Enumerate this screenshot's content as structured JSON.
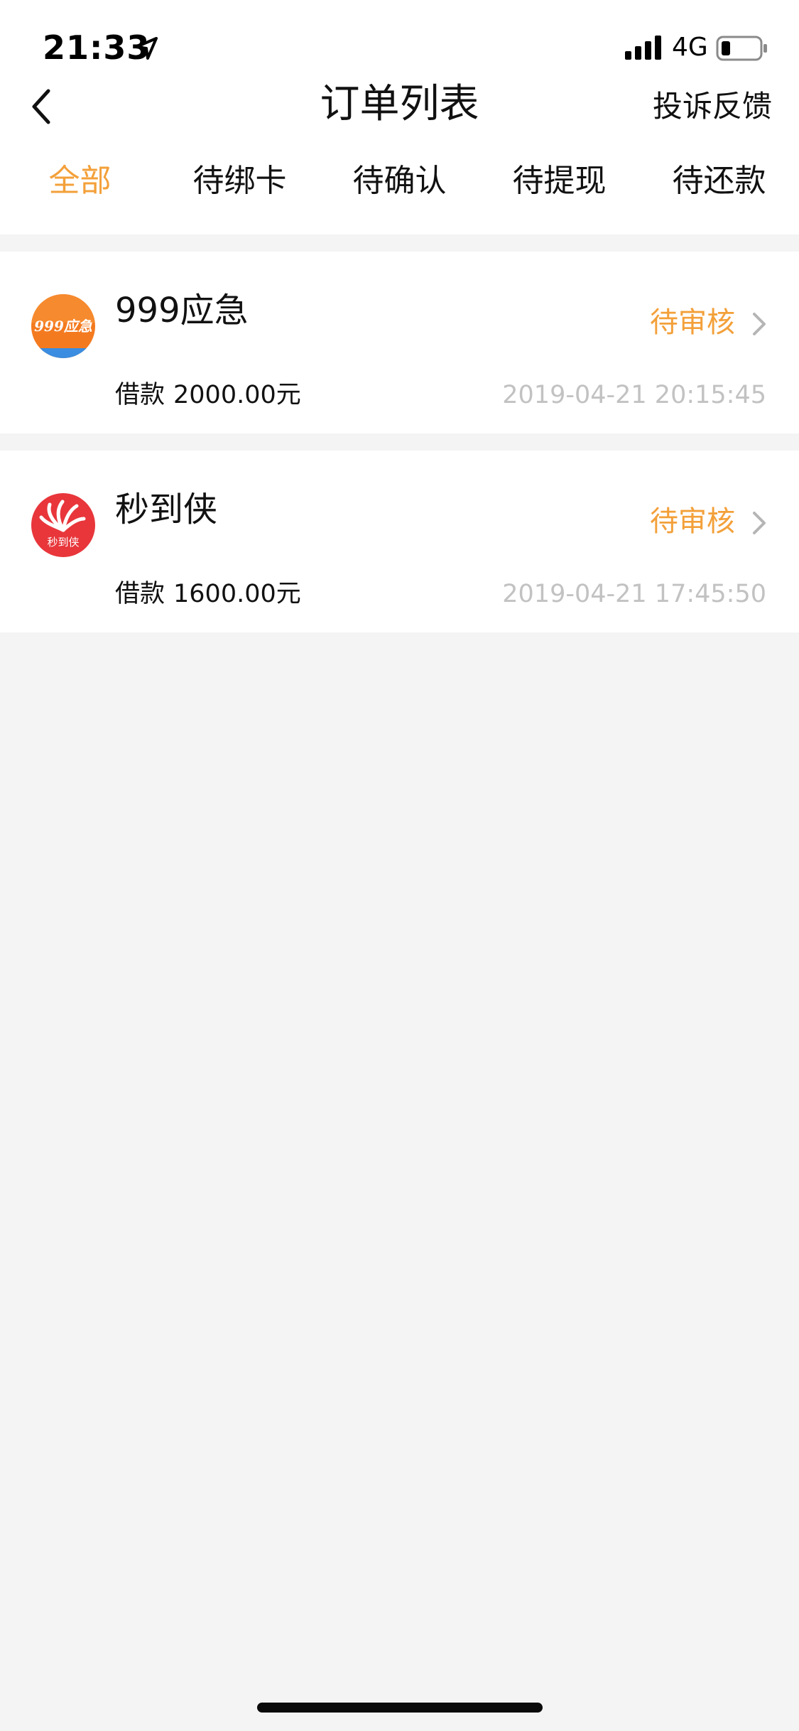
{
  "status_bar": {
    "time": "21:33",
    "network": "4G",
    "icons": [
      "location-arrow-icon",
      "signal-icon",
      "battery-icon"
    ]
  },
  "nav": {
    "title": "订单列表",
    "action": "投诉反馈",
    "back_icon": "chevron-left-icon"
  },
  "tabs": [
    {
      "label": "全部",
      "active": true
    },
    {
      "label": "待绑卡",
      "active": false
    },
    {
      "label": "待确认",
      "active": false
    },
    {
      "label": "待提现",
      "active": false
    },
    {
      "label": "待还款",
      "active": false
    }
  ],
  "orders": [
    {
      "name": "999应急",
      "logo_text": "999应急",
      "status": "待审核",
      "amount_label": "借款",
      "amount": "2000.00元",
      "time": "2019-04-21 20:15:45"
    },
    {
      "name": "秒到侠",
      "logo_text": "秒到侠",
      "status": "待审核",
      "amount_label": "借款",
      "amount": "1600.00元",
      "time": "2019-04-21 17:45:50"
    }
  ],
  "colors": {
    "accent": "#f3a03a",
    "background": "#f4f4f4",
    "muted_text": "#c2c2c2"
  }
}
